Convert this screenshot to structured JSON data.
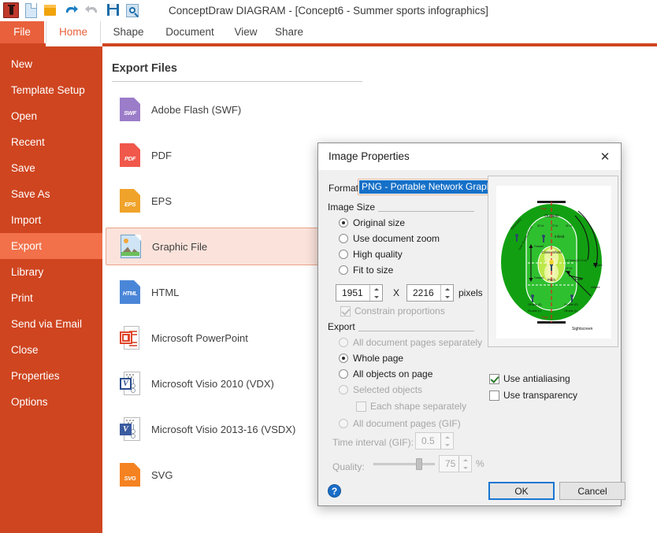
{
  "titlebar": {
    "app_title": "ConceptDraw DIAGRAM - [Concept6 - Summer sports infographics]",
    "quick_access": [
      {
        "name": "app-icon",
        "label": "ConceptDraw"
      },
      {
        "name": "new-document-icon",
        "label": "New"
      },
      {
        "name": "open-folder-icon",
        "label": "Open"
      },
      {
        "name": "undo-icon",
        "label": "Undo"
      },
      {
        "name": "redo-icon",
        "label": "Redo"
      },
      {
        "name": "save-icon",
        "label": "Save"
      },
      {
        "name": "print-preview-icon",
        "label": "Preview"
      }
    ]
  },
  "ribbon": {
    "tabs": [
      {
        "label": "File"
      },
      {
        "label": "Home"
      },
      {
        "label": "Shape"
      },
      {
        "label": "Document"
      },
      {
        "label": "View"
      },
      {
        "label": "Share"
      }
    ],
    "active_tab": "Home",
    "accent_color": "#cf4520"
  },
  "sidebar": {
    "items": [
      {
        "label": "New"
      },
      {
        "label": "Template Setup"
      },
      {
        "label": "Open"
      },
      {
        "label": "Recent"
      },
      {
        "label": "Save"
      },
      {
        "label": "Save As"
      },
      {
        "label": "Import"
      },
      {
        "label": "Export"
      },
      {
        "label": "Library"
      },
      {
        "label": "Print"
      },
      {
        "label": "Send via Email"
      },
      {
        "label": "Close"
      },
      {
        "label": "Properties"
      },
      {
        "label": "Options"
      }
    ],
    "active": "Export",
    "bg_color": "#cf4520",
    "active_color": "#f2714a"
  },
  "main": {
    "heading": "Export Files",
    "files": [
      {
        "label": "Adobe Flash (SWF)",
        "icon": "swf-file-icon",
        "badge": "SWF",
        "selected": false
      },
      {
        "label": "PDF",
        "icon": "pdf-file-icon",
        "badge": "PDF",
        "selected": false
      },
      {
        "label": "EPS",
        "icon": "eps-file-icon",
        "badge": "EPS",
        "selected": false
      },
      {
        "label": "Graphic File",
        "icon": "graphic-file-icon",
        "badge": "",
        "selected": true
      },
      {
        "label": "HTML",
        "icon": "html-file-icon",
        "badge": "HTML",
        "selected": false
      },
      {
        "label": "Microsoft PowerPoint",
        "icon": "powerpoint-file-icon",
        "badge": "",
        "selected": false
      },
      {
        "label": "Microsoft Visio 2010 (VDX)",
        "icon": "visio-vdx-file-icon",
        "badge": "V",
        "selected": false
      },
      {
        "label": "Microsoft Visio 2013-16 (VSDX)",
        "icon": "visio-vsdx-file-icon",
        "badge": "V",
        "selected": false
      },
      {
        "label": "SVG",
        "icon": "svg-file-icon",
        "badge": "SVG",
        "selected": false
      }
    ]
  },
  "dialog": {
    "title": "Image Properties",
    "close_glyph": "✕",
    "format": {
      "label": "Format",
      "value": "PNG - Portable Network Graphics",
      "selection_color": "#1570c8"
    },
    "image_size": {
      "group_label": "Image Size",
      "options": [
        {
          "label": "Original size",
          "checked": true,
          "disabled": false
        },
        {
          "label": "Use document zoom",
          "checked": false,
          "disabled": false
        },
        {
          "label": "High quality",
          "checked": false,
          "disabled": false
        },
        {
          "label": "Fit to size",
          "checked": false,
          "disabled": false
        }
      ],
      "width": "1951",
      "separator": "X",
      "height": "2216",
      "unit": "pixels",
      "constrain": {
        "label": "Constrain proportions",
        "checked": true,
        "disabled": true
      }
    },
    "export": {
      "group_label": "Export",
      "options": [
        {
          "label": "All document pages separately",
          "checked": false,
          "disabled": true
        },
        {
          "label": "Whole page",
          "checked": true,
          "disabled": false
        },
        {
          "label": "All objects on page",
          "checked": false,
          "disabled": false
        },
        {
          "label": "Selected objects",
          "checked": false,
          "disabled": true
        }
      ],
      "each_shape": {
        "label": "Each shape separately",
        "checked": false,
        "disabled": true
      },
      "all_pages_gif": {
        "label": "All document pages (GIF)",
        "checked": false,
        "disabled": true
      },
      "time_interval": {
        "label": "Time interval (GIF):",
        "value": "0.5",
        "disabled": true
      },
      "quality": {
        "label": "Quality:",
        "value": "75",
        "unit": "%",
        "disabled": true,
        "percent": 75
      }
    },
    "checkboxes": [
      {
        "label": "Use antialiasing",
        "checked": true
      },
      {
        "label": "Use transparency",
        "checked": false
      }
    ],
    "buttons": {
      "help": "?",
      "ok": "OK",
      "cancel": "Cancel"
    },
    "preview": {
      "name": "cricket-field-diagram",
      "labels": {
        "outfield": "Outfield",
        "infield": "Infield",
        "close_infield": "Close Infield",
        "pitch": "Pitch",
        "sightscreen": "Sightscreen",
        "boundary": "Boundary",
        "umpire": "Umpire",
        "offside_l": "Off-side (R)",
        "onside_l": "On-side (L)"
      }
    }
  }
}
